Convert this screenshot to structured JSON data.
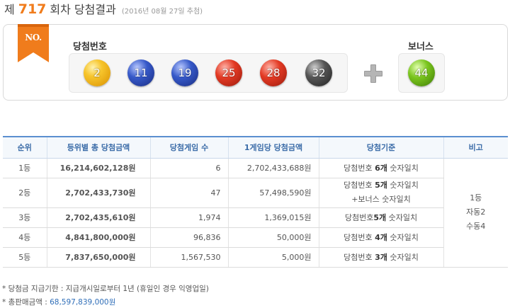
{
  "header": {
    "title_prefix": "제",
    "draw_number": "717",
    "title_suffix": "회차 당첨결과",
    "draw_date": "(2016년 08월 27일 추첨)"
  },
  "winning": {
    "badge": "NO.",
    "numbers_label": "당첨번호",
    "bonus_label": "보너스",
    "numbers": [
      "2",
      "11",
      "19",
      "25",
      "28",
      "32"
    ],
    "bonus": "44",
    "ball_colors": {
      "yellow": "#f7c52c",
      "blue": "#3659c9",
      "red": "#e33a24",
      "gray": "#555555",
      "green": "#7ac51e"
    }
  },
  "table": {
    "headers": [
      "순위",
      "등위별 총 당첨금액",
      "당첨게임 수",
      "1게임당 당첨금액",
      "당첨기준",
      "비고"
    ],
    "rows": [
      {
        "rank": "1등",
        "total": "16,214,602,128원",
        "games": "6",
        "per_game": "2,702,433,688원",
        "crit_pre": "당첨번호 ",
        "crit_bold": "6개",
        "crit_post": " 숫자일치",
        "crit_line2": ""
      },
      {
        "rank": "2등",
        "total": "2,702,433,730원",
        "games": "47",
        "per_game": "57,498,590원",
        "crit_pre": "당첨번호 ",
        "crit_bold": "5개",
        "crit_post": " 숫자일치",
        "crit_line2": "+보너스 숫자일치"
      },
      {
        "rank": "3등",
        "total": "2,702,435,610원",
        "games": "1,974",
        "per_game": "1,369,015원",
        "crit_pre": "당첨번호",
        "crit_bold": "5개",
        "crit_post": " 숫자일치",
        "crit_line2": ""
      },
      {
        "rank": "4등",
        "total": "4,841,800,000원",
        "games": "96,836",
        "per_game": "50,000원",
        "crit_pre": "당첨번호 ",
        "crit_bold": "4개",
        "crit_post": " 숫자일치",
        "crit_line2": ""
      },
      {
        "rank": "5등",
        "total": "7,837,650,000원",
        "games": "1,567,530",
        "per_game": "5,000원",
        "crit_pre": "당첨번호 ",
        "crit_bold": "3개",
        "crit_post": " 숫자일치",
        "crit_line2": ""
      }
    ],
    "note": [
      "1등",
      "자동2",
      "수동4"
    ]
  },
  "footer": {
    "payout_note": "* 당첨금 지급기한 : 지급개시일로부터 1년 (휴일인 경우 익영업일)",
    "sales_label": "* 총판매금액 : ",
    "sales_value": "68,597,839,000원"
  }
}
